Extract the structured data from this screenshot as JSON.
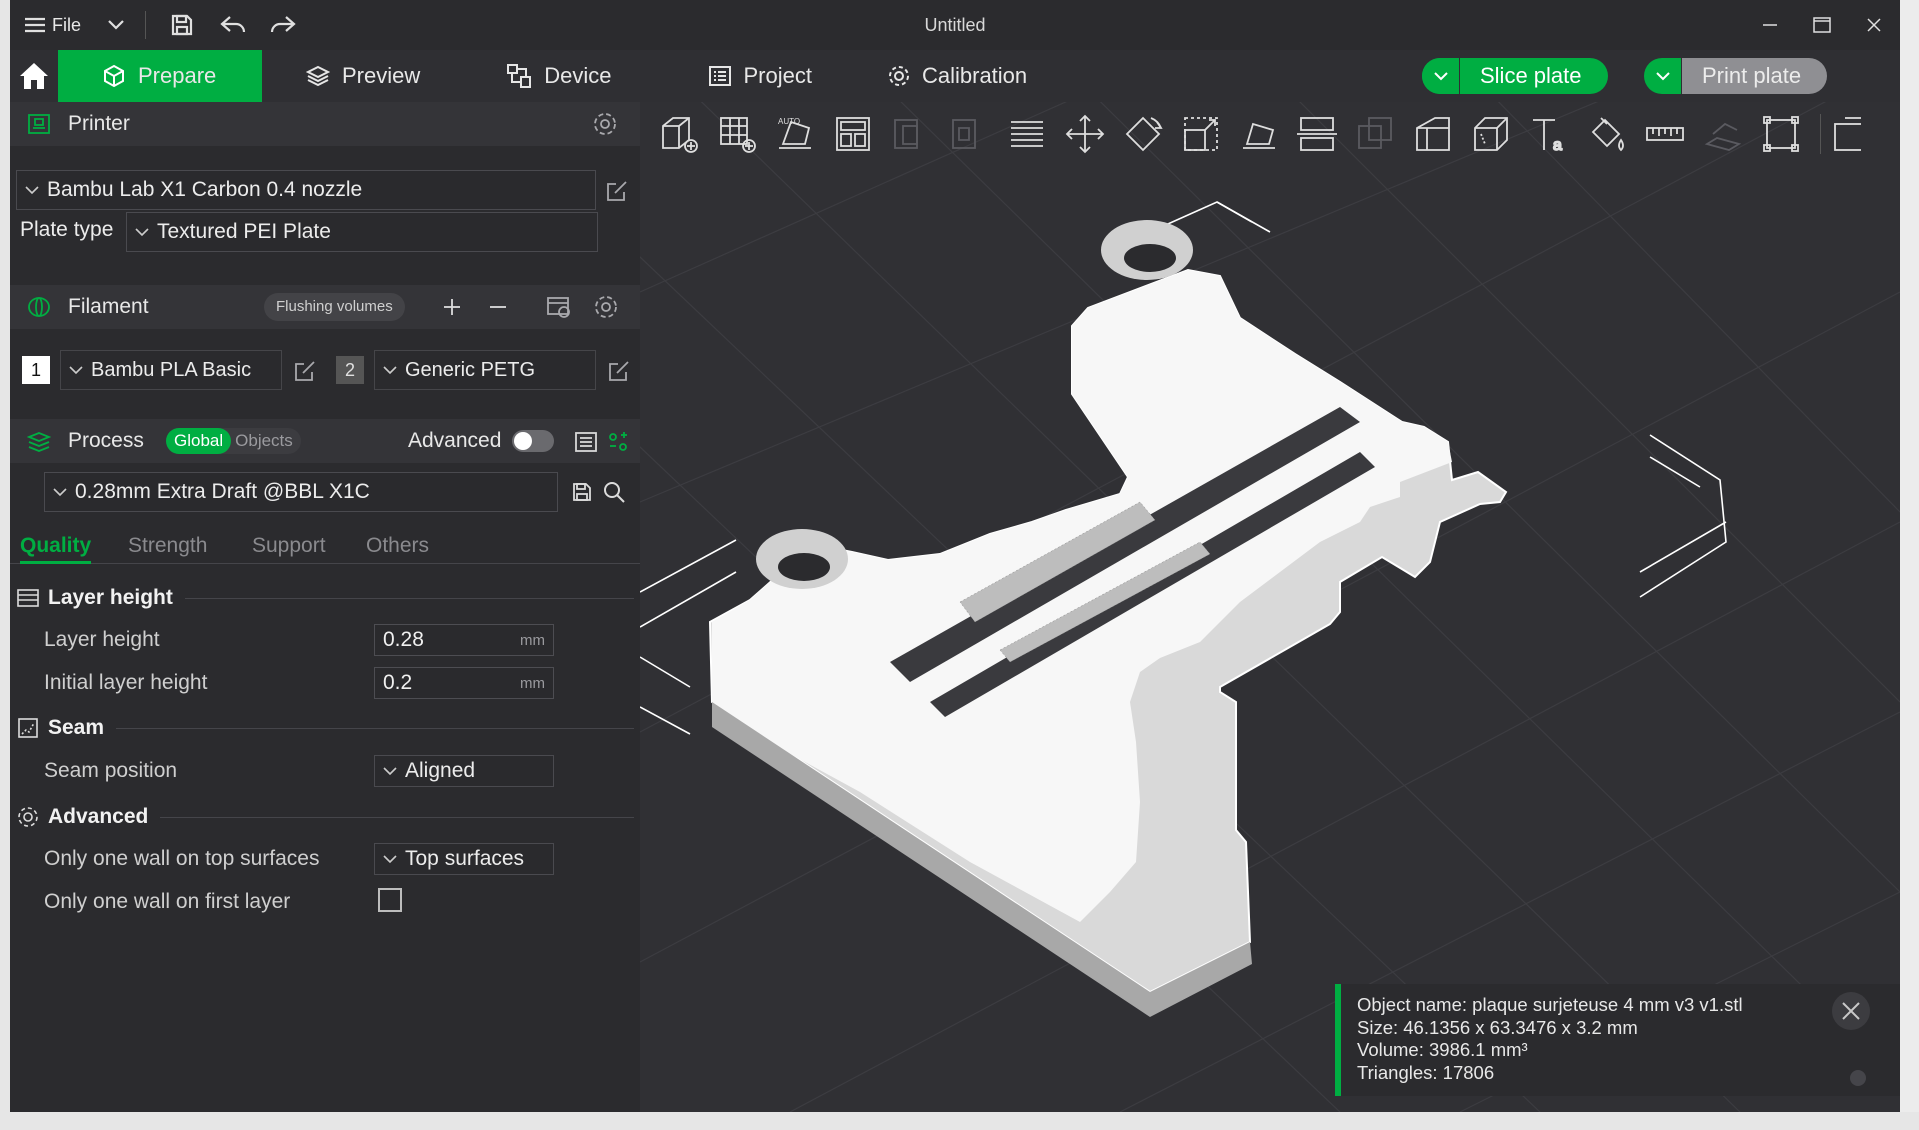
{
  "window": {
    "title": "Untitled"
  },
  "titlebar": {
    "file_label": "File"
  },
  "nav": {
    "tabs": [
      {
        "label": "Prepare"
      },
      {
        "label": "Preview"
      },
      {
        "label": "Device"
      },
      {
        "label": "Project"
      },
      {
        "label": "Calibration"
      }
    ],
    "slice_label": "Slice plate",
    "print_label": "Print plate"
  },
  "printer": {
    "section_label": "Printer",
    "selected": "Bambu Lab X1 Carbon 0.4 nozzle",
    "plate_type_label": "Plate type",
    "plate_type_value": "Textured PEI Plate"
  },
  "filament": {
    "section_label": "Filament",
    "flushing_label": "Flushing volumes",
    "slots": [
      {
        "index": "1",
        "name": "Bambu PLA Basic",
        "color": "#ffffff"
      },
      {
        "index": "2",
        "name": "Generic PETG",
        "color": "#555555"
      }
    ]
  },
  "process": {
    "section_label": "Process",
    "global_label": "Global",
    "objects_label": "Objects",
    "advanced_label": "Advanced",
    "advanced_enabled": false,
    "preset": "0.28mm Extra Draft @BBL X1C",
    "tabs": [
      "Quality",
      "Strength",
      "Support",
      "Others"
    ],
    "active_tab": "Quality"
  },
  "settings": {
    "layer_height_group": "Layer height",
    "layer_height_label": "Layer height",
    "layer_height_value": "0.28",
    "initial_layer_height_label": "Initial layer height",
    "initial_layer_height_value": "0.2",
    "unit": "mm",
    "seam_group": "Seam",
    "seam_position_label": "Seam position",
    "seam_position_value": "Aligned",
    "advanced_group": "Advanced",
    "one_wall_top_label": "Only one wall on top surfaces",
    "one_wall_top_value": "Top surfaces",
    "one_wall_first_label": "Only one wall on first layer",
    "one_wall_first_checked": false
  },
  "object_info": {
    "name_line": "Object name: plaque surjeteuse 4 mm v3 v1.stl",
    "size_line": "Size: 46.1356 x 63.3476 x 3.2 mm",
    "volume_line": "Volume: 3986.1 mm³",
    "triangles_line": "Triangles: 17806"
  },
  "colors": {
    "accent": "#00ae42",
    "background": "#2a2a2d",
    "viewport": "#303034"
  }
}
